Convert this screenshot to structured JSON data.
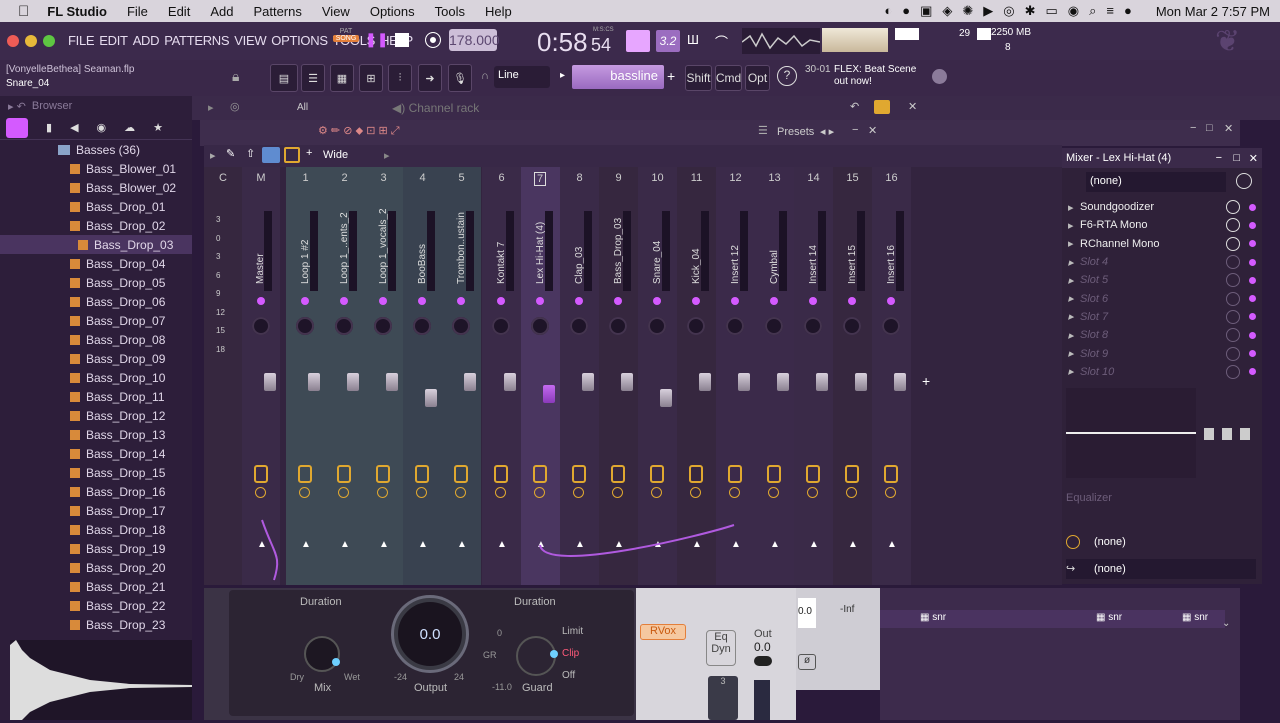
{
  "macbar": {
    "app": "FL Studio",
    "menus": [
      "File",
      "Edit",
      "Add",
      "Patterns",
      "View",
      "Options",
      "Tools",
      "Help"
    ],
    "datetime": "Mon Mar 2  7:57 PM"
  },
  "toolbar": {
    "menus": [
      "FILE",
      "EDIT",
      "ADD",
      "PATTERNS",
      "VIEW",
      "OPTIONS",
      "TOOLS",
      "HELP"
    ],
    "pat": "PAT",
    "song": "SONG",
    "tempo": "178.000",
    "time": "0:58",
    "time_frac": "54",
    "time_unit": "M:S:CS",
    "cpu_voices": "29",
    "memory": "2250 MB",
    "poly": "8"
  },
  "toolbar2": {
    "project": "[VonyelleBethea] Seaman.flp",
    "selected": "Snare_04",
    "snap": "Line",
    "pattern": "bassline",
    "keys": [
      "Shift",
      "Cmd",
      "Opt"
    ],
    "hint_date": "30-01",
    "hint": "FLEX: Beat Scene out now!"
  },
  "browser": {
    "title": "Browser",
    "folder": "Basses (36)",
    "items": [
      "Bass_Blower_01",
      "Bass_Blower_02",
      "Bass_Drop_01",
      "Bass_Drop_02",
      "Bass_Drop_03",
      "Bass_Drop_04",
      "Bass_Drop_05",
      "Bass_Drop_06",
      "Bass_Drop_07",
      "Bass_Drop_08",
      "Bass_Drop_09",
      "Bass_Drop_10",
      "Bass_Drop_11",
      "Bass_Drop_12",
      "Bass_Drop_13",
      "Bass_Drop_14",
      "Bass_Drop_15",
      "Bass_Drop_16",
      "Bass_Drop_17",
      "Bass_Drop_18",
      "Bass_Drop_19",
      "Bass_Drop_20",
      "Bass_Drop_21",
      "Bass_Drop_22",
      "Bass_Drop_23"
    ],
    "selected_index": 4
  },
  "channel_rack": {
    "all": "All",
    "title": "Channel rack"
  },
  "presets": "Presets",
  "mixer": {
    "mode": "Wide",
    "scale": [
      "3",
      "0",
      "3",
      "6",
      "9",
      "12",
      "15",
      "18"
    ],
    "strips": [
      {
        "num": "C",
        "name": ""
      },
      {
        "num": "M",
        "name": "Master"
      },
      {
        "num": "1",
        "name": "Loop 1 #2"
      },
      {
        "num": "2",
        "name": "Loop 1_..ents_2"
      },
      {
        "num": "3",
        "name": "Loop 1_vocals_2"
      },
      {
        "num": "4",
        "name": "BooBass"
      },
      {
        "num": "5",
        "name": "Trombon..ustain"
      },
      {
        "num": "6",
        "name": "Kontakt 7"
      },
      {
        "num": "7",
        "name": "Lex Hi-Hat (4)"
      },
      {
        "num": "8",
        "name": "Clap_03"
      },
      {
        "num": "9",
        "name": "Bass_Drop_03"
      },
      {
        "num": "10",
        "name": "Snare_04"
      },
      {
        "num": "11",
        "name": "Kick_04"
      },
      {
        "num": "12",
        "name": "Insert 12"
      },
      {
        "num": "13",
        "name": "Cymbal"
      },
      {
        "num": "14",
        "name": "Insert 14"
      },
      {
        "num": "15",
        "name": "Insert 15"
      },
      {
        "num": "16",
        "name": "Insert 16"
      }
    ]
  },
  "mixer_panel": {
    "title": "Mixer - Lex Hi-Hat (4)",
    "input": "(none)",
    "slots": [
      "Soundgoodizer",
      "F6-RTA Mono",
      "RChannel Mono",
      "Slot 4",
      "Slot 5",
      "Slot 6",
      "Slot 7",
      "Slot 8",
      "Slot 9",
      "Slot 10"
    ],
    "eq_label": "Equalizer",
    "out1": "(none)",
    "out2": "(none)"
  },
  "plugin": {
    "duration1": "Duration",
    "duration2": "Duration",
    "mix": "Mix",
    "dry": "Dry",
    "wet": "Wet",
    "output_value": "0.0",
    "output": "Output",
    "out_min": "-24",
    "out_max": "24",
    "gr": "GR",
    "gr_zero": "0",
    "limit": "Limit",
    "clip": "Clip",
    "off": "Off",
    "guard": "Guard",
    "guard_value": "-11.0"
  },
  "plugin2": {
    "rvox": "RVox",
    "eq": "Eq",
    "dyn": "Dyn",
    "out": "Out",
    "out_value": "0.0",
    "num": "3"
  },
  "plugin3": {
    "inf": "-Inf",
    "val": "0.0"
  },
  "playlist": {
    "clips": [
      "snr",
      "snr",
      "snr"
    ]
  }
}
